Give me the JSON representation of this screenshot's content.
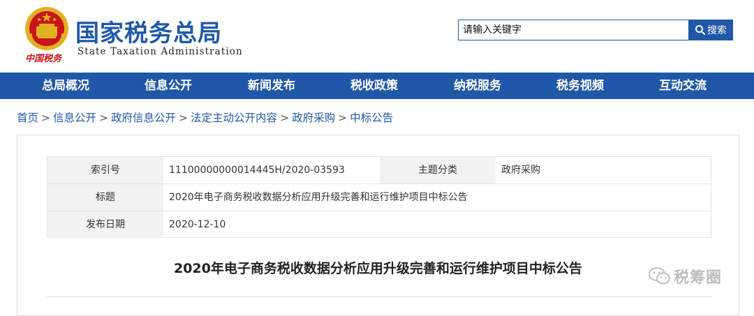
{
  "header": {
    "title": "国家税务总局",
    "subtitle": "State Taxation Administration",
    "slogan": "中国税务"
  },
  "search": {
    "placeholder": "请输入关键字",
    "button_label": "搜索"
  },
  "nav": {
    "items": [
      {
        "label": "总局概况"
      },
      {
        "label": "信息公开"
      },
      {
        "label": "新闻发布"
      },
      {
        "label": "税收政策"
      },
      {
        "label": "纳税服务"
      },
      {
        "label": "税务视频"
      },
      {
        "label": "互动交流"
      }
    ]
  },
  "breadcrumb": {
    "items": [
      "首页",
      "信息公开",
      "政府信息公开",
      "法定主动公开内容",
      "政府采购",
      "中标公告"
    ],
    "separator": ">"
  },
  "meta": {
    "index_label": "索引号",
    "index_value": "11100000000014445H/2020-03593",
    "category_label": "主题分类",
    "category_value": "政府采购",
    "title_label": "标题",
    "title_value": "2020年电子商务税收数据分析应用升级完善和运行维护项目中标公告",
    "date_label": "发布日期",
    "date_value": "2020-12-10"
  },
  "article": {
    "title": "2020年电子商务税收数据分析应用升级完善和运行维护项目中标公告"
  },
  "watermark": {
    "text": "税筹圈"
  },
  "colors": {
    "brand_blue": "#2058a8",
    "emblem_red": "#c8161d",
    "emblem_gold": "#e2b021"
  }
}
